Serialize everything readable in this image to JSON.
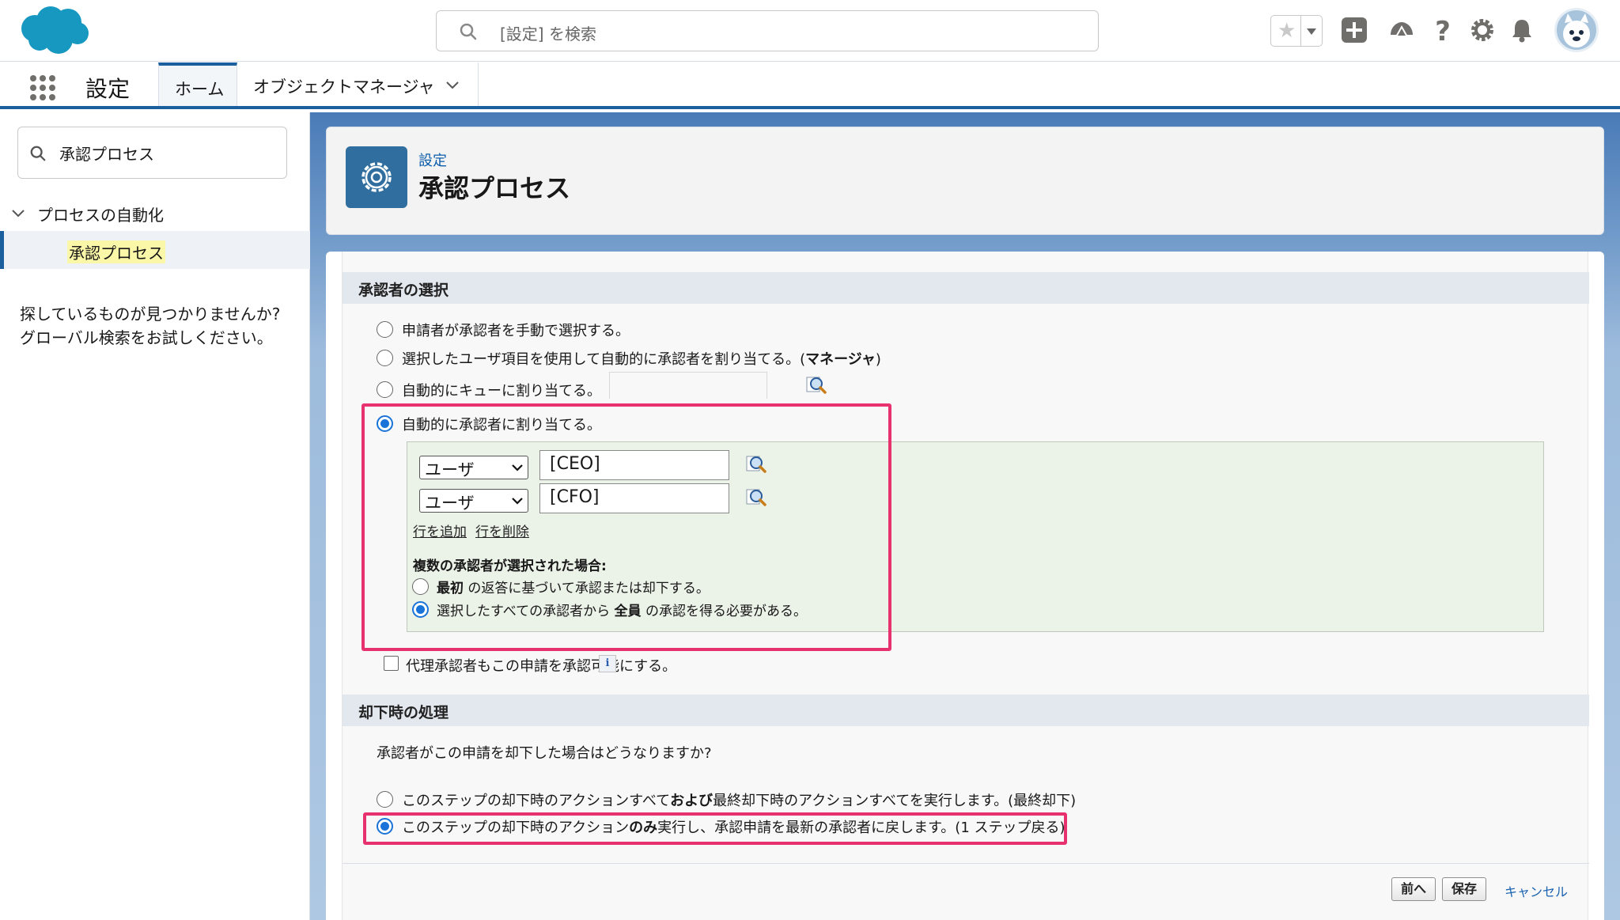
{
  "header": {
    "search_placeholder": "[設定] を検索",
    "icons": [
      "star-icon",
      "add-icon",
      "trailhead-icon",
      "help-icon",
      "gear-icon",
      "bell-icon",
      "avatar"
    ]
  },
  "nav": {
    "app_title": "設定",
    "tabs": [
      {
        "label": "ホーム",
        "active": true
      },
      {
        "label": "オブジェクトマネージャ",
        "active": false
      }
    ]
  },
  "sidebar": {
    "quickfind_value": "承認プロセス",
    "tree_parent": "プロセスの自動化",
    "tree_child": "承認プロセス",
    "help_line1": "探しているものが見つかりませんか?",
    "help_line2": "グローバル検索をお試しください。"
  },
  "page_header": {
    "breadcrumb": "設定",
    "title": "承認プロセス"
  },
  "approver_section": {
    "heading": "承認者の選択",
    "options": [
      {
        "label": "申請者が承認者を手動で選択する。",
        "selected": false
      },
      {
        "label_prefix": "選択したユーザ項目を使用して自動的に承認者を割り当てる。(",
        "label_bold": "マネージャ",
        "label_suffix": ")",
        "selected": false
      },
      {
        "label": "自動的にキューに割り当てる。",
        "selected": false
      },
      {
        "label": "自動的に承認者に割り当てる。",
        "selected": true
      }
    ],
    "approver_rows": [
      {
        "type": "ユーザ",
        "value": "[CEO]"
      },
      {
        "type": "ユーザ",
        "value": "[CFO]"
      }
    ],
    "add_row_link": "行を追加",
    "delete_row_link": "行を削除",
    "multi_label": "複数の承認者が選択された場合:",
    "multi_options": [
      {
        "bold": "最初",
        "rest": " の返答に基づいて承認または却下する。",
        "selected": false
      },
      {
        "prefix": "選択したすべての承認者から ",
        "bold": "全員",
        "rest": " の承認を得る必要がある。",
        "selected": true
      }
    ],
    "delegate_checkbox_label": "代理承認者もこの申請を承認可能にする。",
    "delegate_checked": false,
    "info_glyph": "i"
  },
  "rejection_section": {
    "heading": "却下時の処理",
    "question": "承認者がこの申請を却下した場合はどうなりますか?",
    "option1_prefix": "このステップの却下時のアクションすべて",
    "option1_bold": "および",
    "option1_suffix": "最終却下時のアクションすべてを実行します。(最終却下)",
    "option1_selected": false,
    "option2_prefix": "このステップの却下時のアクション",
    "option2_bold": "のみ",
    "option2_suffix": "実行し、承認申請を最新の承認者に戻します。(1 ステップ戻る)",
    "option2_selected": true
  },
  "footer": {
    "prev_label": "前へ",
    "save_label": "保存",
    "cancel_label": "キャンセル"
  },
  "colors": {
    "brand_blue": "#1b5f9e",
    "radio_blue": "#1a73d9",
    "highlight_pink": "#e8326f",
    "green_panel": "#ebf2e8"
  }
}
